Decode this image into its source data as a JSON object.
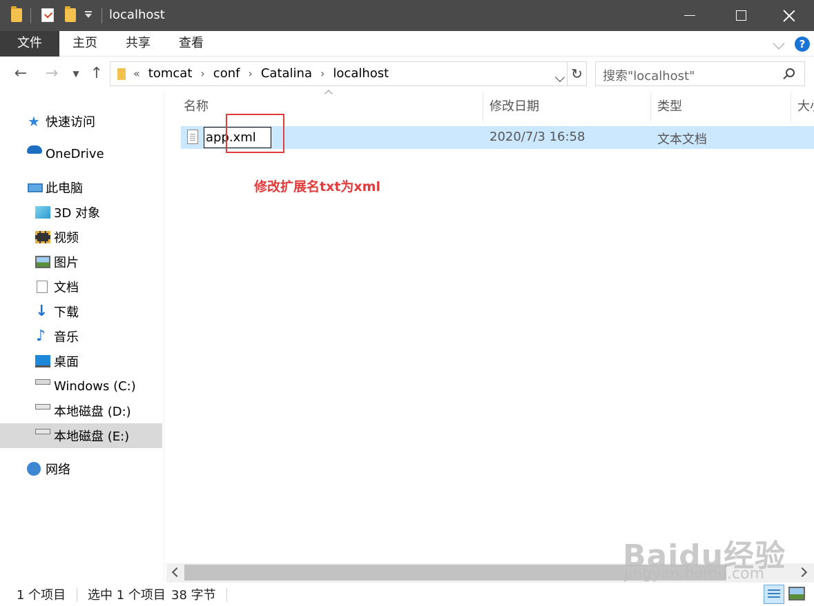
{
  "window": {
    "title": "localhost"
  },
  "ribbon": {
    "tabs": [
      "文件",
      "主页",
      "共享",
      "查看"
    ]
  },
  "address": {
    "lead": "«",
    "crumbs": [
      "tomcat",
      "conf",
      "Catalina",
      "localhost"
    ],
    "separator": "›"
  },
  "search": {
    "placeholder": "搜索\"localhost\""
  },
  "sidebar": {
    "quick_access": "快速访问",
    "onedrive": "OneDrive",
    "this_pc": "此电脑",
    "items": [
      {
        "label": "3D 对象",
        "icon": "cube-icon"
      },
      {
        "label": "视频",
        "icon": "video-icon"
      },
      {
        "label": "图片",
        "icon": "pictures-icon"
      },
      {
        "label": "文档",
        "icon": "documents-icon"
      },
      {
        "label": "下载",
        "icon": "download-icon"
      },
      {
        "label": "音乐",
        "icon": "music-icon"
      },
      {
        "label": "桌面",
        "icon": "desktop-icon"
      },
      {
        "label": "Windows (C:)",
        "icon": "drive-icon"
      },
      {
        "label": "本地磁盘 (D:)",
        "icon": "drive-icon"
      },
      {
        "label": "本地磁盘 (E:)",
        "icon": "drive-icon",
        "selected": true
      }
    ],
    "network": "网络"
  },
  "columns": {
    "name": "名称",
    "modified": "修改日期",
    "type": "类型",
    "size": "大小"
  },
  "file": {
    "name": "app.xml",
    "modified": "2020/7/3 16:58",
    "type": "文本文档"
  },
  "annotation": {
    "text": "修改扩展名txt为xml",
    "color": "#e23b3b"
  },
  "status": {
    "count": "1 个项目",
    "selected": "选中 1 个项目",
    "size": "38 字节"
  },
  "watermark": {
    "logo": "Baidu经验",
    "url": "jingyan.baidu.com"
  }
}
